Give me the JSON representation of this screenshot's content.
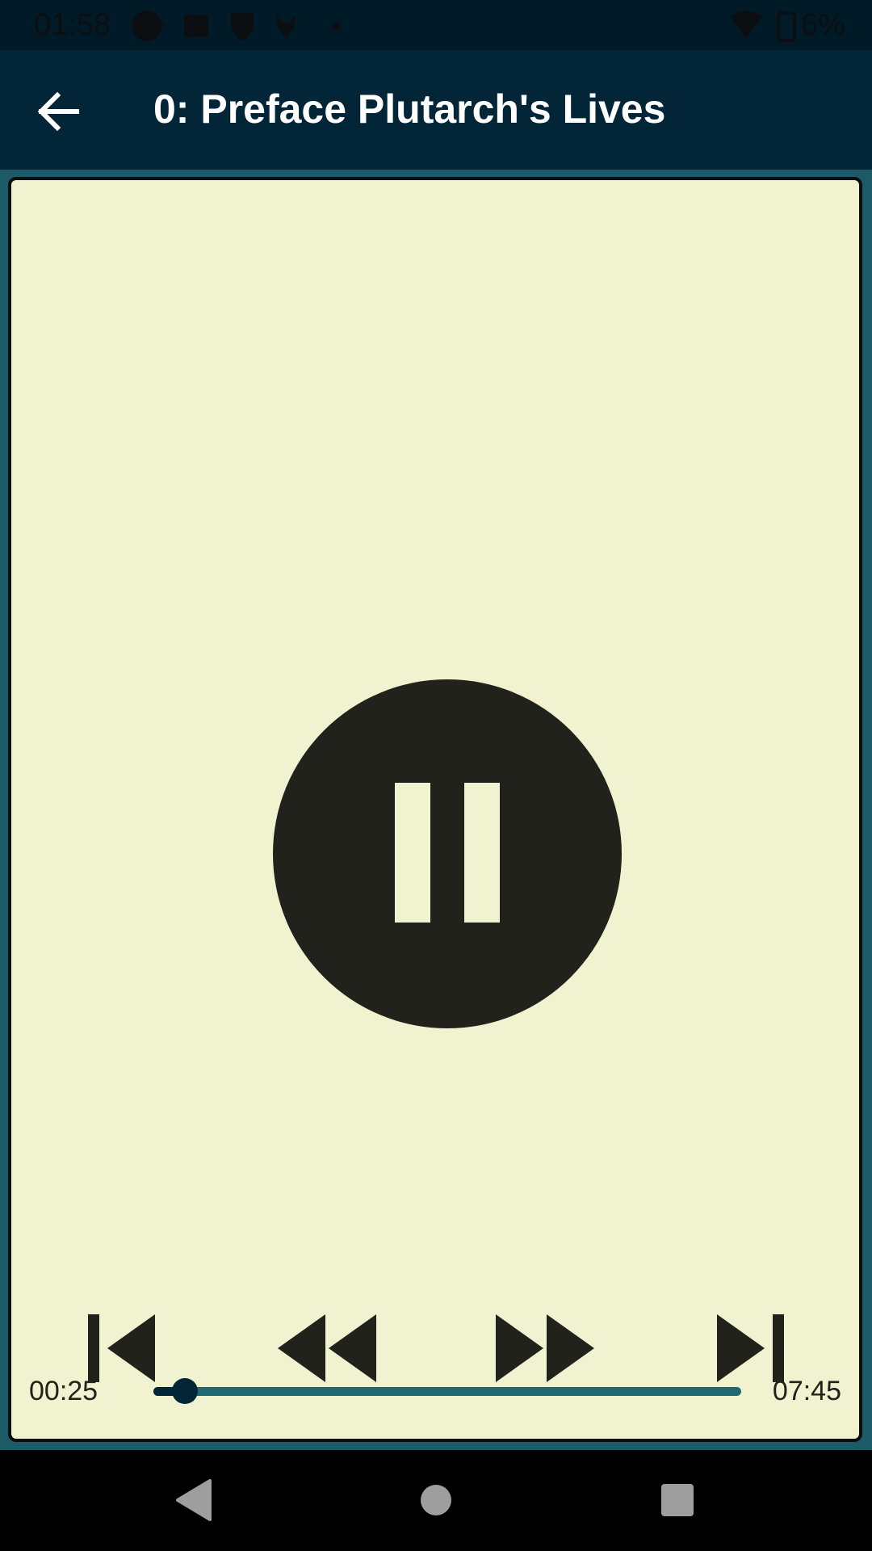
{
  "status_bar": {
    "time": "01:58",
    "battery_text": "6%",
    "icons_left": [
      "circle-icon",
      "image-icon",
      "shield-icon",
      "bull-icon",
      "dot-icon"
    ],
    "icons_right": [
      "wifi-icon",
      "battery-icon"
    ]
  },
  "app_bar": {
    "title": "0: Preface Plutarch's Lives",
    "back_icon": "arrow-left-icon"
  },
  "player": {
    "state_icon": "pause-icon",
    "elapsed": "00:25",
    "duration": "07:45",
    "progress_fraction": 0.054
  },
  "controls": [
    "skip-previous-icon",
    "rewind-icon",
    "fast-forward-icon",
    "skip-next-icon"
  ],
  "nav_bar": [
    "back-triangle-icon",
    "home-circle-icon",
    "recents-square-icon"
  ],
  "colors": {
    "app_bar": "#022537",
    "card_background": "#f1f2d0",
    "accent_teal": "#1f6a72",
    "icon_dark": "#22221d"
  }
}
